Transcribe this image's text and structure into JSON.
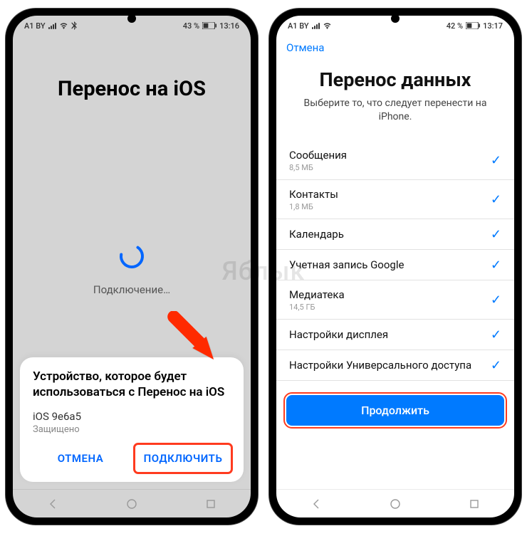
{
  "watermark": "Яблык",
  "phone1": {
    "status": {
      "carrier": "A1 BY",
      "battery_pct": "43 %",
      "time": "13:16"
    },
    "title": "Перенос на iOS",
    "connecting": "Подключение…",
    "sheet": {
      "title": "Устройство, которое будет использоваться с Перенос на iOS",
      "device": "iOS 9e6a5",
      "secure": "Защищено",
      "cancel": "ОТМЕНА",
      "connect": "ПОДКЛЮЧИТЬ"
    }
  },
  "phone2": {
    "status": {
      "carrier": "A1 BY",
      "battery_pct": "42 %",
      "time": "13:17"
    },
    "cancel": "Отмена",
    "title": "Перенос данных",
    "subtitle": "Выберите то, что следует перенести на iPhone.",
    "items": [
      {
        "label": "Сообщения",
        "sub": "8,5 МБ",
        "checked": true
      },
      {
        "label": "Контакты",
        "sub": "1,8 МБ",
        "checked": true
      },
      {
        "label": "Календарь",
        "sub": "",
        "checked": true
      },
      {
        "label": "Учетная запись Google",
        "sub": "",
        "checked": true
      },
      {
        "label": "Медиатека",
        "sub": "14,5 ГБ",
        "checked": true
      },
      {
        "label": "Настройки дисплея",
        "sub": "",
        "checked": true
      },
      {
        "label": "Настройки Универсального доступа",
        "sub": "",
        "checked": true
      }
    ],
    "continue": "Продолжить"
  }
}
